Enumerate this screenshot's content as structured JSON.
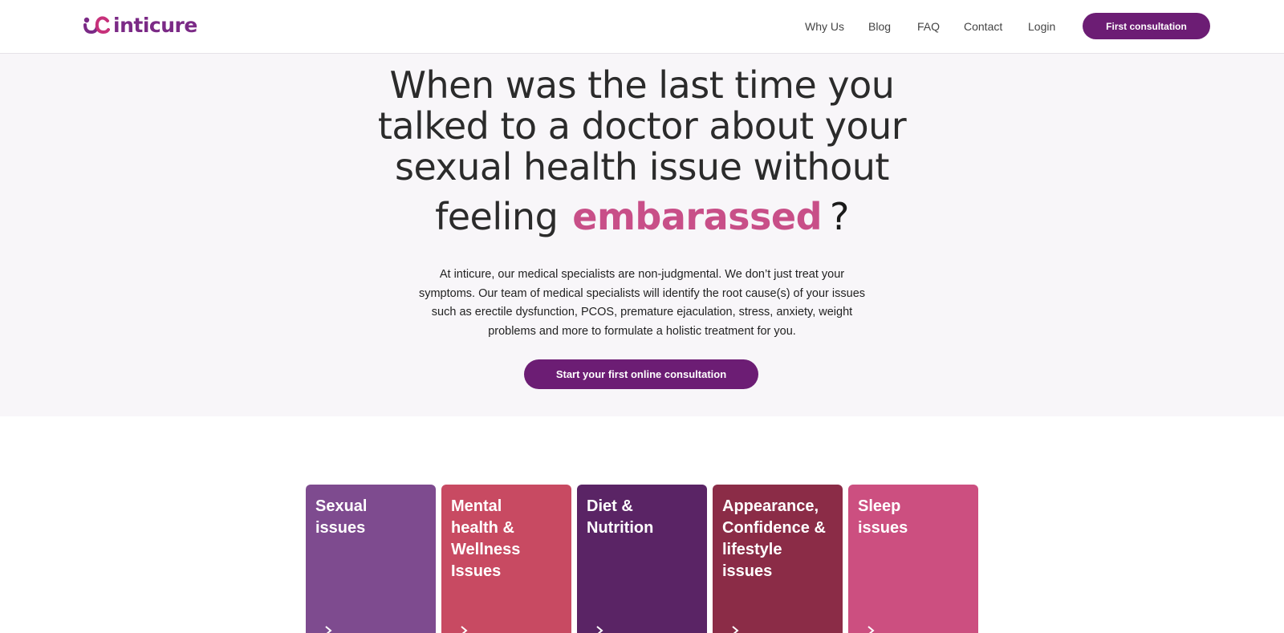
{
  "brand": {
    "name": "inticure",
    "colors": {
      "primary": "#6c1d74",
      "accent": "#c84f88",
      "hero_bg": "#f8f6f9"
    }
  },
  "nav": {
    "links": [
      "Why Us",
      "Blog",
      "FAQ",
      "Contact",
      "Login"
    ],
    "cta": "First consultation"
  },
  "hero": {
    "headline_lines": [
      "When was the last time you",
      "talked to a doctor about your",
      "sexual health issue without"
    ],
    "headline_feeling": "feeling",
    "headline_emphasis": "embarassed",
    "headline_question": "?",
    "lead": "At inticure, our medical specialists are non-judgmental. We don’t just treat your symptoms. Our team of medical specialists will identify the root cause(s) of your issues such as erectile dysfunction, PCOS, premature ejaculation, stress, anxiety, weight problems and more to formulate a holistic treatment for you.",
    "cta": "Start your first online consultation"
  },
  "categories": [
    {
      "title": "Sexual issues",
      "color": "#7e4b8f",
      "icon": "arrow-right-icon"
    },
    {
      "title": "Mental health & Wellness Issues",
      "color": "#c84a62",
      "icon": "arrow-right-icon"
    },
    {
      "title": "Diet & Nutrition",
      "color": "#5a2465",
      "icon": "arrow-right-icon"
    },
    {
      "title": "Appearance, Confidence & lifestyle issues",
      "color": "#8b2c47",
      "icon": "arrow-right-icon"
    },
    {
      "title": "Sleep issues",
      "color": "#cc4f80",
      "icon": "arrow-right-icon"
    }
  ]
}
